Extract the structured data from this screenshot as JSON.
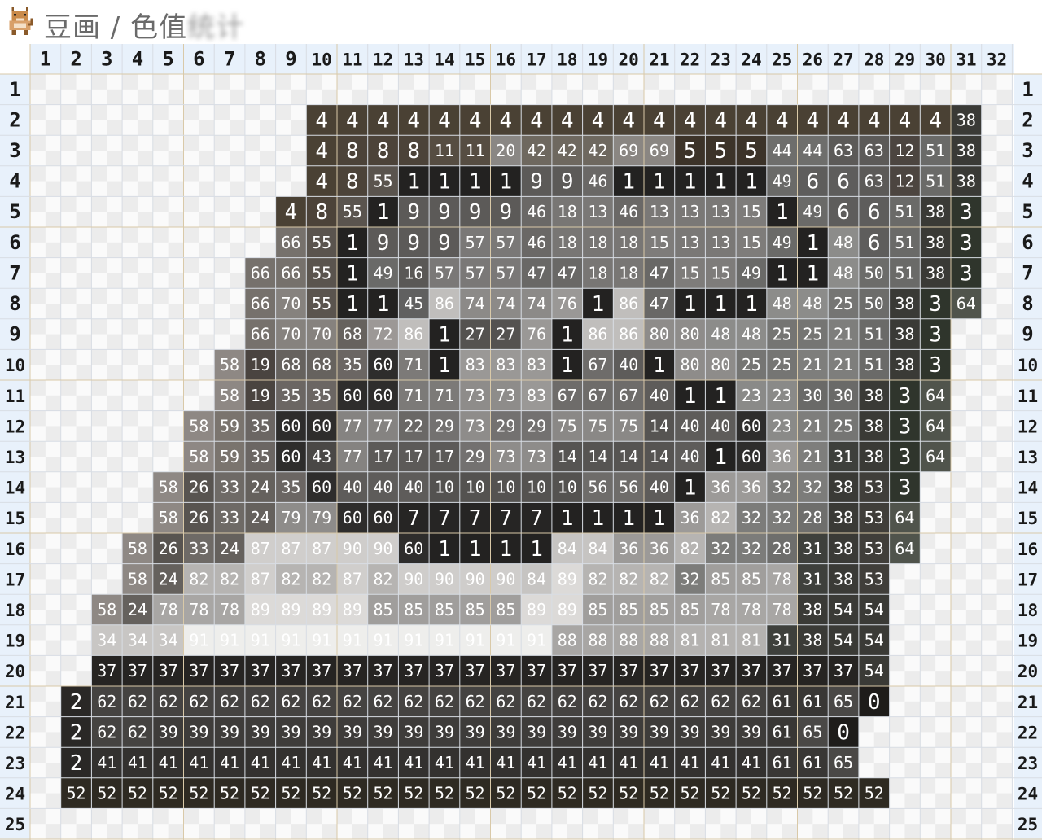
{
  "header": {
    "title": "豆画 / 色值统计",
    "title_visible": "豆画 / 色值",
    "title_blurred": "统计",
    "logo_icon": "pixel-cat-logo-icon"
  },
  "grid": {
    "columns": 32,
    "rows": 25,
    "column_labels": [
      "1",
      "2",
      "3",
      "4",
      "5",
      "6",
      "7",
      "8",
      "9",
      "10",
      "11",
      "12",
      "13",
      "14",
      "15",
      "16",
      "17",
      "18",
      "19",
      "20",
      "21",
      "22",
      "23",
      "24",
      "25",
      "26",
      "27",
      "28",
      "29",
      "30",
      "31",
      "32"
    ],
    "row_labels": [
      "1",
      "2",
      "3",
      "4",
      "5",
      "6",
      "7",
      "8",
      "9",
      "10",
      "11",
      "12",
      "13",
      "14",
      "15",
      "16",
      "17",
      "18",
      "19",
      "20",
      "21",
      "22",
      "23",
      "24",
      "25"
    ],
    "cells": [
      "",
      "_ _ _ _ _ _ _ _ _ 4 4 4 4 4 4 4 4 4 4 4 4 4 4 4 4 4 4 4 4 4 38",
      "_ _ _ _ _ _ _ _ _ 4 8 8 8 11 11 20 42 42 42 69 69 5 5 5 44 44 63 63 12 51 38",
      "_ _ _ _ _ _ _ _ _ 4 8 55 1 1 1 1 9 9 46 1 1 1 1 1 49 6 6 63 12 51 38",
      "_ _ _ _ _ _ _ _ 4 8 55 1 9 9 9 9 46 18 13 46 13 13 13 15 1 49 6 6 51 38 3",
      "_ _ _ _ _ _ _ _ 66 55 1 9 9 9 57 57 46 18 18 18 15 13 13 15 49 1 48 6 51 38 3",
      "_ _ _ _ _ _ _ 66 66 55 1 49 16 57 57 57 47 47 18 18 47 15 15 49 1 1 48 50 51 38 3",
      "_ _ _ _ _ _ _ 66 70 55 1 1 45 86 74 74 74 76 1 86 47 1 1 1 48 48 25 50 38 3 64",
      "_ _ _ _ _ _ _ 66 70 70 68 72 86 1 27 27 76 1 86 86 80 80 48 48 25 25 21 51 38 3",
      "_ _ _ _ _ _ 58 19 68 68 35 60 71 1 83 83 83 1 67 40 1 80 80 25 25 21 21 51 38 3",
      "_ _ _ _ _ _ 58 19 35 35 60 60 71 71 73 73 83 67 67 67 40 1 1 23 23 30 30 38 3 64",
      "_ _ _ _ _ 58 59 35 60 60 77 77 22 29 73 29 29 75 75 75 14 40 40 60 23 21 25 38 3 64",
      "_ _ _ _ _ 58 59 35 60 43 77 17 17 17 29 73 73 14 14 14 14 40 1 60 36 21 31 38 3 64",
      "_ _ _ _ 58 26 33 24 35 60 40 40 40 10 10 10 10 10 56 56 40 1 36 36 32 32 38 53 3",
      "_ _ _ _ 58 26 33 24 79 79 60 60 7 7 7 7 7 1 1 1 1 36 82 32 32 28 38 53 64",
      "_ _ _ 58 26 33 24 87 87 87 90 90 60 1 1 1 1 84 84 36 36 82 32 32 28 31 38 53 64",
      "_ _ _ 58 24 82 82 87 82 82 87 82 90 90 90 90 84 89 82 82 82 32 85 85 78 31 38 53",
      "_ _ 58 24 78 78 78 89 89 89 89 85 85 85 85 85 89 89 85 85 85 85 78 78 78 38 54 54",
      "_ _ 34 34 34 91 91 91 91 91 91 91 91 91 91 91 91 88 88 88 88 81 81 81 31 38 54 54",
      "_ _ 37 37 37 37 37 37 37 37 37 37 37 37 37 37 37 37 37 37 37 37 37 37 37 37 37 54",
      "_ 2 62 62 62 62 62 62 62 62 62 62 62 62 62 62 62 62 62 62 62 62 62 62 61 61 65 0",
      "_ 2 62 62 39 39 39 39 39 39 39 39 39 39 39 39 39 39 39 39 39 39 39 39 61 65 0",
      "_ 2 41 41 41 41 41 41 41 41 41 41 41 41 41 41 41 41 41 41 41 41 41 41 61 61 65",
      "_ 52 52 52 52 52 52 52 52 52 52 52 52 52 52 52 52 52 52 52 52 52 52 52 52 52 52 52",
      ""
    ],
    "palette": {
      "0": "#1e1c1a",
      "1": "#232221",
      "2": "#2a2826",
      "3": "#2f352c",
      "4": "#4a4134",
      "5": "#3c3329",
      "6": "#5e5d5c",
      "7": "#262524",
      "8": "#4c4339",
      "9": "#5c5a58",
      "10": "#545250",
      "11": "#564d42",
      "12": "#4c4540",
      "13": "#7a7876",
      "14": "#565452",
      "15": "#7e7c7a",
      "16": "#5a5856",
      "17": "#5c5a58",
      "18": "#787674",
      "19": "#4a4440",
      "20": "#8a8784",
      "21": "#7e7e7c",
      "22": "#6a6866",
      "23": "#8a8a88",
      "24": "#65615d",
      "25": "#757573",
      "26": "#585450",
      "27": "#545250",
      "28": "#6e6e6c",
      "29": "#737170",
      "30": "#6a6a68",
      "31": "#3e403c",
      "32": "#7c7c7a",
      "33": "#6e6a66",
      "34": "#c8c6c4",
      "35": "#6b6663",
      "36": "#9c9a98",
      "37": "#262422",
      "38": "#3a3a36",
      "39": "#3e3c3a",
      "40": "#5e5c5a",
      "41": "#33312f",
      "42": "#6e685f",
      "43": "#4a4846",
      "44": "#6e6e6c",
      "45": "#606060",
      "46": "#6a6866",
      "47": "#696866",
      "48": "#8c8c8a",
      "49": "#6a6a68",
      "50": "#6c6c6a",
      "51": "#6a6a68",
      "52": "#2e2a22",
      "53": "#403e3a",
      "54": "#3a3a36",
      "55": "#5a544e",
      "56": "#6e6c6a",
      "57": "#7a7877",
      "58": "#8e8884",
      "59": "#7a746e",
      "60": "#2e2d2c",
      "61": "#393735",
      "62": "#454341",
      "63": "#5c5a58",
      "64": "#50544c",
      "65": "#4a4846",
      "66": "#76716c",
      "67": "#6e6c6a",
      "68": "#66625e",
      "69": "#8a8682",
      "70": "#86827e",
      "71": "#7c7a78",
      "72": "#9c9896",
      "73": "#8e8c8a",
      "74": "#8c8a88",
      "75": "#8a8886",
      "76": "#9a9896",
      "77": "#858381",
      "78": "#a8a6a4",
      "79": "#8e8c8a",
      "80": "#8e8c8a",
      "81": "#b4b2b0",
      "82": "#b6b4b2",
      "83": "#9a9896",
      "84": "#c6c4c2",
      "85": "#a09e9c",
      "86": "#c0bebc",
      "87": "#d0cecc",
      "88": "#a8a6a4",
      "89": "#dcdad8",
      "90": "#cfcdcb",
      "91": "#eeeeec"
    },
    "header_color": "#e8f1fb",
    "header_text_color": "#1a1a1a",
    "empty_color_a": "#fafafa",
    "empty_color_b": "#ececec",
    "cell_text_color": "#ffffff"
  }
}
